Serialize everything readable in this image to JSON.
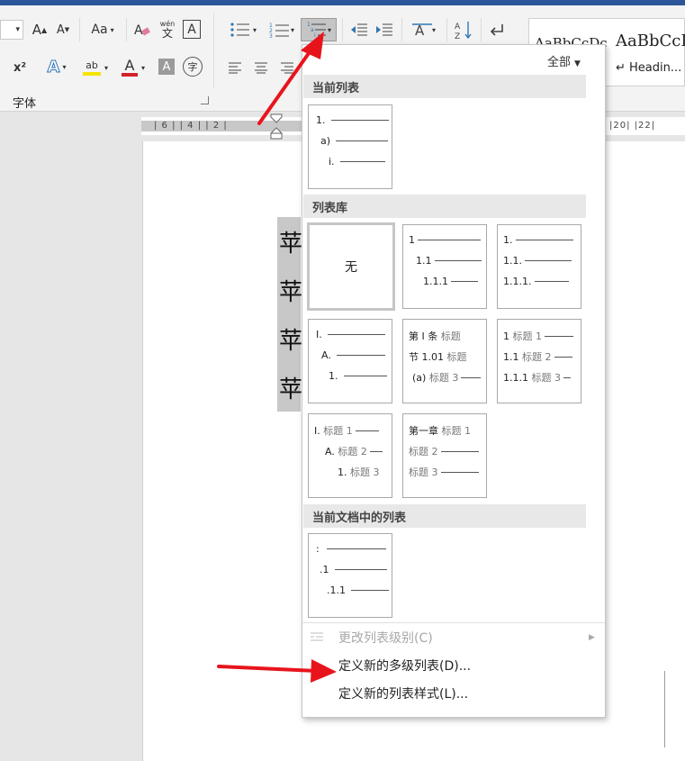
{
  "ribbon": {
    "font_group_label": "字体",
    "font_size_caret": "▾",
    "grow_font": "A",
    "shrink_font": "A",
    "change_case": "Aa",
    "phonetic_top": "wén",
    "phonetic_bottom": "文",
    "char_border": "A",
    "superscript": "x²",
    "text_effect": "A",
    "highlight": "ab",
    "font_color": "A",
    "char_shading": "A",
    "enclose_char": "字",
    "sort": "A↓Z",
    "styles_filter": "全部",
    "style_normal_sample": "AaBbCcDc",
    "style_heading_sample": "AaBbCcI",
    "style_heading_label": "↵ Headin..."
  },
  "ruler": {
    "left_ticks": "| 6 |   | 4 |   | 2 |",
    "right_ticks": "|20|   |22|"
  },
  "document": {
    "lines": [
      "苹",
      "苹",
      "苹",
      "苹"
    ]
  },
  "dropdown": {
    "section_current": "当前列表",
    "section_library": "列表库",
    "section_in_doc": "当前文档中的列表",
    "none_label": "无",
    "current_list": [
      "1.",
      "a)",
      "i."
    ],
    "tile_numeric": [
      "1",
      "1.1",
      "1.1.1"
    ],
    "tile_numeric_dot": [
      "1.",
      "1.1.",
      "1.1.1."
    ],
    "tile_roman": [
      "I.",
      "A.",
      "1."
    ],
    "tile_article": [
      {
        "num": "第 I 条",
        "lbl": "标题"
      },
      {
        "num": "节 1.01",
        "lbl": "标题"
      },
      {
        "num": "(a)",
        "lbl": "标题 3"
      }
    ],
    "tile_heading_num": [
      {
        "num": "1",
        "lbl": "标题 1"
      },
      {
        "num": "1.1",
        "lbl": "标题 2"
      },
      {
        "num": "1.1.1",
        "lbl": "标题 3"
      }
    ],
    "tile_heading_roman": [
      {
        "num": "I.",
        "lbl": "标题 1"
      },
      {
        "num": "A.",
        "lbl": "标题 2"
      },
      {
        "num": "1.",
        "lbl": "标题 3"
      }
    ],
    "tile_chapter": [
      {
        "num": "第一章",
        "lbl": "标题 1"
      },
      {
        "num": "",
        "lbl": "标题 2"
      },
      {
        "num": "",
        "lbl": "标题 3"
      }
    ],
    "doc_list": [
      ":",
      ".1",
      ".1.1"
    ],
    "menu": {
      "change_level": "更改列表级别(C)",
      "define_new_multilevel": "定义新的多级列表(D)...",
      "define_new_style": "定义新的列表样式(L)..."
    }
  },
  "colors": {
    "title_bar": "#2b579a",
    "annotation_arrow": "#e8141c",
    "highlight_bar": "#f5e400",
    "font_color_bar": "#d3202a"
  }
}
